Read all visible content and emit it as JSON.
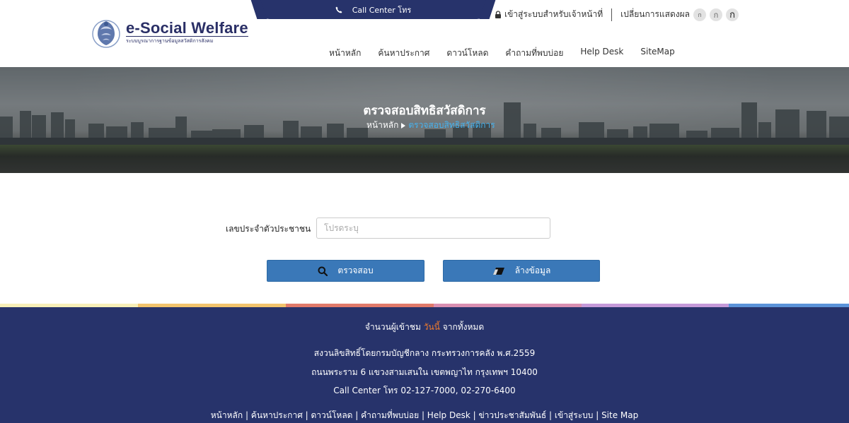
{
  "header": {
    "call_center_label": "Call Center โทร",
    "logo_title": "e-Social Welfare",
    "logo_subtitle": "ระบบบูรณาการฐานข้อมูลสวัสดิการสังคม",
    "login_officer_label": "เข้าสู่ระบบสำหรับเจ้าหน้าที่",
    "display_change_label": "เปลี่ยนการแสดงผล",
    "font_size_buttons": [
      "ก",
      "ก",
      "ก"
    ]
  },
  "nav": {
    "items": [
      "หน้าหลัก",
      "ค้นหาประกาศ",
      "ดาวน์โหลด",
      "คำถามที่พบบ่อย",
      "Help Desk",
      "SiteMap"
    ]
  },
  "banner": {
    "title": "ตรวจสอบสิทธิสวัสดิการ",
    "breadcrumb_home": "หน้าหลัก",
    "breadcrumb_current": "ตรวจสอบสิทธิสวัสดิการ"
  },
  "form": {
    "id_label": "เลขประจำตัวประชาชน",
    "id_value": "",
    "id_placeholder": "โปรดระบุ",
    "check_button": "ตรวจสอบ",
    "clear_button": "ล้างข้อมูล"
  },
  "strip_colors": [
    "#f7efb8",
    "#f2c46d",
    "#e07a6a",
    "#d98fb1",
    "#c59ad9",
    "#5b93d9"
  ],
  "footer": {
    "visitors_prefix": "จำนวนผู้เข้าชม",
    "visitors_today": "วันนี้",
    "visitors_suffix": "จากทั้งหมด",
    "copyright": "สงวนลิขสิทธิ์โดยกรมบัญชีกลาง กระทรวงการคลัง พ.ศ.2559",
    "address": "ถนนพระราม 6 แขวงสามเสนใน เขตพญาไท กรุงเทพฯ 10400",
    "call_center": "Call Center โทร 02-127-7000, 02-270-6400",
    "links": [
      "หน้าหลัก",
      "ค้นหาประกาศ",
      "ดาวน์โหลด",
      "คำถามที่พบบ่อย",
      "Help Desk",
      "ข่าวประชาสัมพันธ์",
      "เข้าสู่ระบบ",
      "Site Map"
    ],
    "link_separator": " | "
  },
  "colors": {
    "navy": "#27336b",
    "button_blue": "#3a78b8",
    "breadcrumb_current": "#46b3f0",
    "today_highlight": "#f07b2c"
  },
  "icons": [
    "phone-icon",
    "lock-icon",
    "search-icon",
    "eraser-icon",
    "emblem-logo"
  ]
}
